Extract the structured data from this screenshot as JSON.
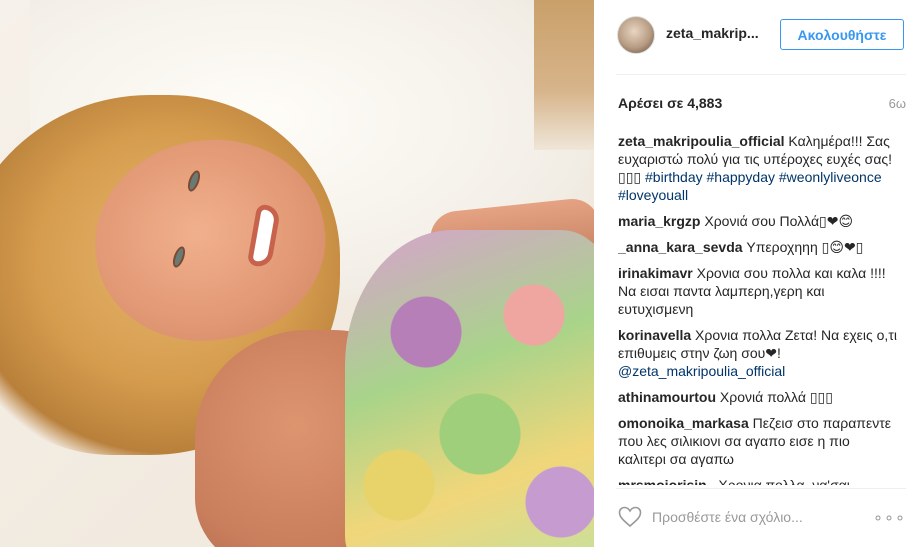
{
  "post": {
    "photo_icon": "photo"
  },
  "header": {
    "username": "zeta_makrip...",
    "follow_label": "Ακολουθήστε"
  },
  "meta": {
    "likes": "Αρέσει σε 4,883",
    "age": "6ω"
  },
  "comments": [
    {
      "user": "zeta_makripoulia_official",
      "text": " Καλημέρα!!! Σας ευχαριστώ πολύ για τις υπέροχες ευχές σας!▯▯▯ ",
      "tags": "#birthday #happyday #weonlyliveonce #loveyouall"
    },
    {
      "user": "maria_krgzp",
      "text": " Χρονιά σου Πολλά▯❤😊",
      "tags": ""
    },
    {
      "user": "_anna_kara_sevda",
      "text": " Υπεροχηηη ▯😊❤▯",
      "tags": ""
    },
    {
      "user": "irinakimavr",
      "text": " Χρονια σου πολλα και καλα !!!! Να εισαι παντα λαμπερη,γερη και ευτυχισμενη",
      "tags": ""
    },
    {
      "user": "korinavella",
      "text": " Χρονια πολλα Ζετα! Να εχεις ο,τι επιθυμεις στην ζωη σου❤! ",
      "tags": "@zeta_makripoulia_official"
    },
    {
      "user": "athinamourtou",
      "text": " Χρονιά πολλά ▯▯▯",
      "tags": ""
    },
    {
      "user": "omonoika_markasa",
      "text": " Πεζεισ στο παραπεντε που λες σιλικιονι σα αγαπο εισε η πιο καλιτερι σα αγαπω",
      "tags": ""
    },
    {
      "user": "mrsmojorisin",
      "text": "   Χρονια πολλα, να'σαι",
      "tags": ""
    }
  ],
  "footer": {
    "comment_placeholder": "Προσθέστε ένα σχόλιο...",
    "more_label": "∘∘∘"
  },
  "colors": {
    "link": "#3897f0",
    "hashtag": "#003569",
    "muted": "#999999"
  }
}
